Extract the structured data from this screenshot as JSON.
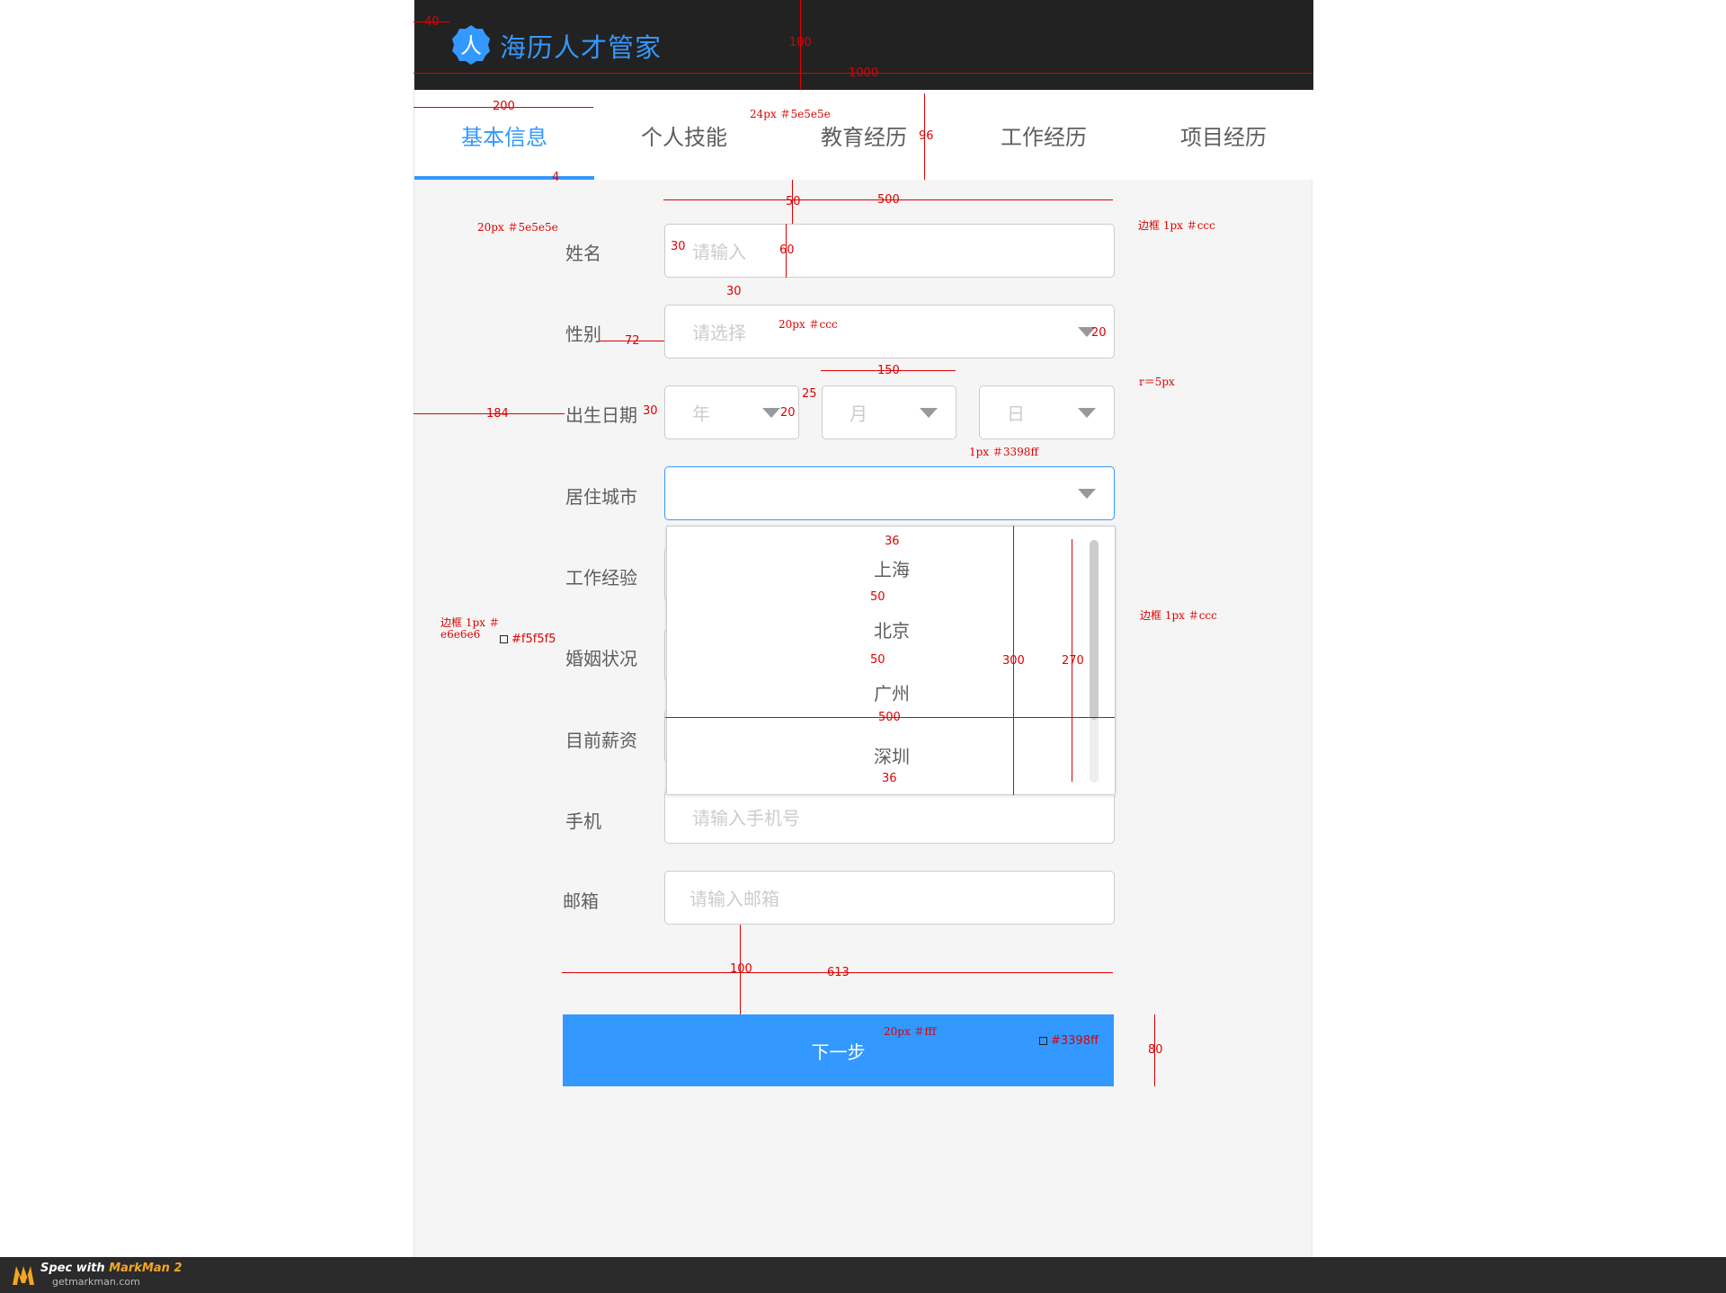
{
  "app": {
    "title": "海历人才管家",
    "logo_glyph": "人",
    "accent_color": "#3398ff"
  },
  "tabs": [
    {
      "label": "基本信息",
      "active": true
    },
    {
      "label": "个人技能",
      "active": false
    },
    {
      "label": "教育经历",
      "active": false
    },
    {
      "label": "工作经历",
      "active": false
    },
    {
      "label": "项目经历",
      "active": false
    }
  ],
  "form": {
    "name": {
      "label": "姓名",
      "placeholder": "请输入"
    },
    "gender": {
      "label": "性别",
      "placeholder": "请选择"
    },
    "birth": {
      "label": "出生日期",
      "year": "年",
      "month": "月",
      "day": "日"
    },
    "city": {
      "label": "居住城市",
      "value": "",
      "options": [
        "上海",
        "北京",
        "广州",
        "深圳"
      ]
    },
    "work_exp": {
      "label": "工作经验"
    },
    "marital": {
      "label": "婚姻状况"
    },
    "salary": {
      "label": "目前薪资"
    },
    "phone": {
      "label": "手机",
      "placeholder": "请输入手机号"
    },
    "email": {
      "label": "邮箱",
      "placeholder": "请输入邮箱"
    },
    "next_button": "下一步"
  },
  "annotations": {
    "header_height": "100",
    "header_width": "1000",
    "logo_offset": "40",
    "tab_width": "200",
    "tab_font": "24px ＃5e5e5e",
    "tab_height": "96",
    "tab_underline": "4",
    "label_font": "20px ＃5e5e5e",
    "top_gap": "50",
    "input_width": "500",
    "input_border": "边框 1px ＃ccc",
    "ph_padding": "30",
    "input_height": "60",
    "row_gap": "30",
    "ph_font": "20px ＃ccc",
    "label_gap": "72",
    "caret_right": "20",
    "date_width": "150",
    "date_gap": "25",
    "radius": "r＝5px",
    "left_offset": "184",
    "date_ph_padding": "30",
    "date_caret": "20",
    "focus_border": "1px ＃3398ff",
    "opt_pad_top": "36",
    "opt_gap1": "50",
    "opt_gap2": "50",
    "dropdown_height": "300",
    "scroll_height": "270",
    "dropdown_width": "500",
    "opt_pad_bottom": "36",
    "dropdown_border": "边框 1px ＃ccc",
    "frame_border": "边框 1px ＃e6e6e6",
    "bg_color": "#f5f5f5",
    "button_gap": "100",
    "button_width": "613",
    "button_font": "20px ＃fff",
    "button_color": "#3398ff",
    "button_height": "80"
  },
  "footer": {
    "line1_prefix": "Spec with ",
    "line1_brand": "MarkMan 2",
    "line2": "getmarkman.com"
  }
}
